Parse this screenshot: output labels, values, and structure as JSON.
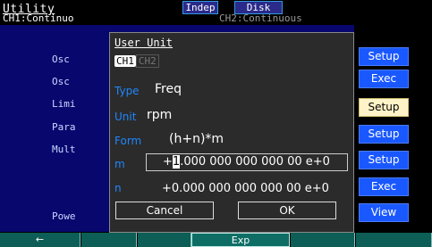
{
  "header": {
    "title": "Utility",
    "indep": "Indep",
    "disk": "Disk",
    "ch1_status": "CH1:Continuo",
    "ch2_status": "CH2:Continuous"
  },
  "background_rows": [
    "Osc",
    "Osc",
    "Limi",
    "Para",
    "Mult",
    "Powe"
  ],
  "softkeys": [
    "Setup",
    "Exec",
    "Setup",
    "Setup",
    "Setup",
    "Exec",
    "View"
  ],
  "fkeys": {
    "back": "←",
    "exp": "Exp"
  },
  "dialog": {
    "title": "User Unit",
    "ch1": "CH1",
    "ch2": "CH2",
    "type_label": "Type",
    "type_value": "Freq",
    "unit_label": "Unit",
    "unit_value": "rpm",
    "form_label": "Form",
    "form_value": "(h+n)*m",
    "m_label": "m",
    "m_prefix": "+",
    "m_cursor": "1",
    "m_rest": ".000 000 000 000 00 e+0",
    "n_label": "n",
    "n_value": "+0.000 000 000 000 00 e+0",
    "cancel": "Cancel",
    "ok": "OK"
  },
  "colors": {
    "panel_bg": "#07076e",
    "softkey": "#1a58ff",
    "label_blue": "#1f86ff",
    "fkey": "#0d5e56"
  }
}
